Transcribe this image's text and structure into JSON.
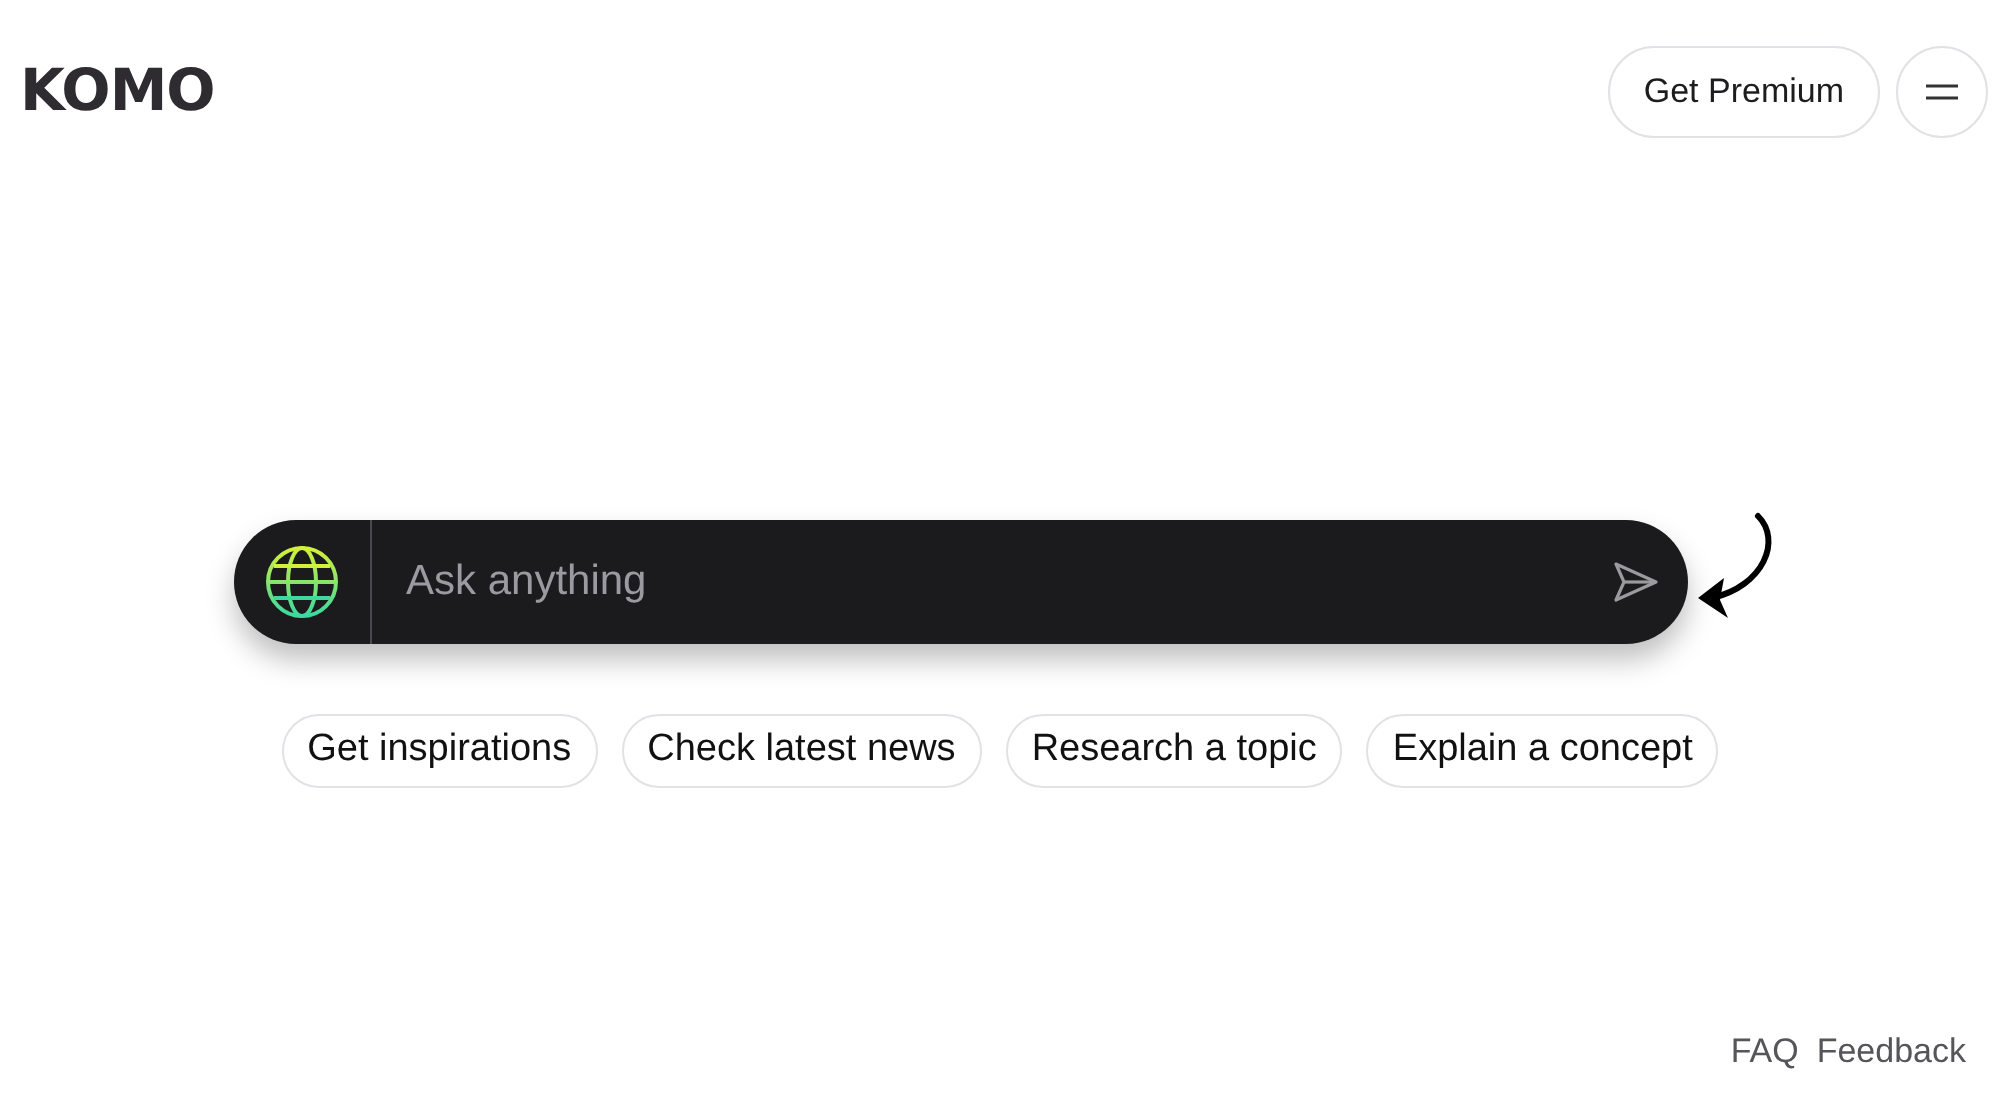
{
  "logo": "KOMO",
  "header": {
    "premium_button": "Get Premium"
  },
  "search": {
    "placeholder": "Ask anything"
  },
  "suggestions": [
    "Get inspirations",
    "Check latest news",
    "Research a topic",
    "Explain a concept"
  ],
  "footer": {
    "links": [
      "FAQ",
      "Feedback"
    ]
  }
}
